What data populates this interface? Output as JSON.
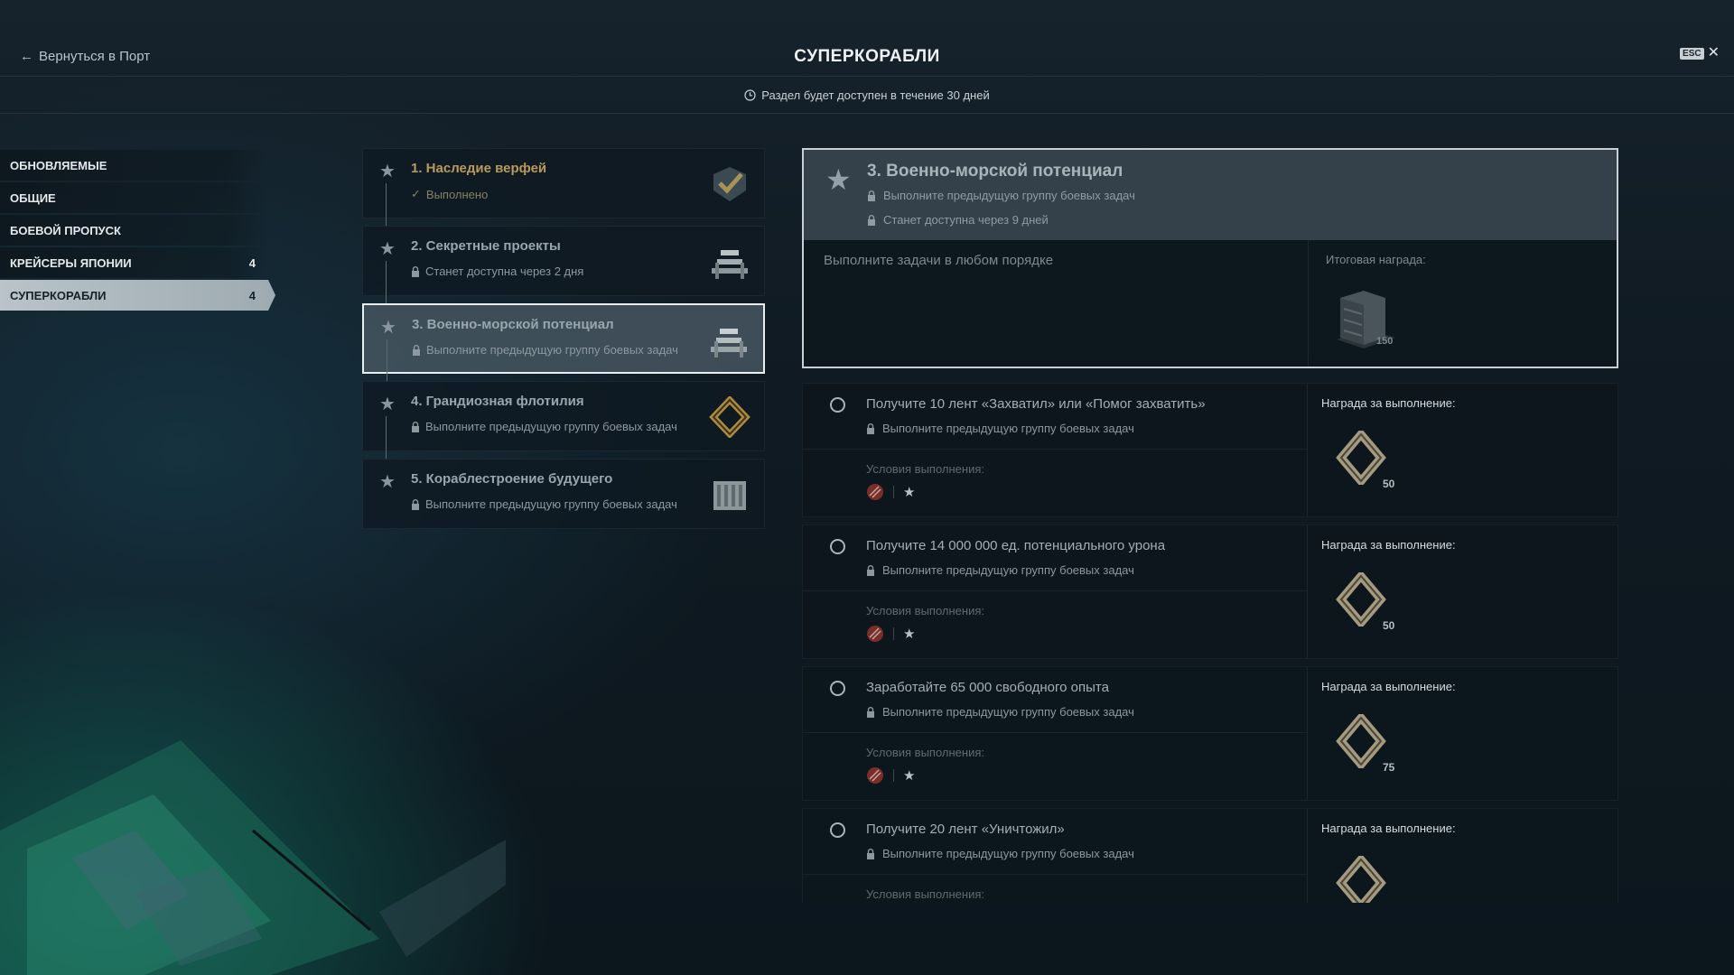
{
  "header": {
    "back_label": "Вернуться в Порт",
    "title": "СУПЕРКОРАБЛИ",
    "esc_key": "ESC",
    "close_glyph": "✕"
  },
  "availability": {
    "text": "Раздел будет доступен в течение 30 дней",
    "icon": "clock-icon"
  },
  "sidebar": {
    "items": [
      {
        "label": "ОБНОВЛЯЕМЫЕ",
        "count": ""
      },
      {
        "label": "ОБЩИЕ",
        "count": ""
      },
      {
        "label": "БОЕВОЙ ПРОПУСК",
        "count": ""
      },
      {
        "label": "КРЕЙСЕРЫ ЯПОНИИ",
        "count": "4"
      },
      {
        "label": "СУПЕРКОРАБЛИ",
        "count": "4",
        "active": true
      }
    ]
  },
  "groups": [
    {
      "title": "1. Наследие верфей",
      "status": "Выполнено",
      "state": "done",
      "icon": "checkmark-badge-icon"
    },
    {
      "title": "2. Секретные проекты",
      "status": "Станет доступна через 2 дня",
      "state": "locked",
      "icon": "steel-ingots-icon"
    },
    {
      "title": "3. Военно-морской потенциал",
      "status": "Выполните предыдущую группу боевых задач",
      "state": "locked",
      "selected": true,
      "icon": "steel-ingots-icon"
    },
    {
      "title": "4. Грандиозная флотилия",
      "status": "Выполните предыдущую группу боевых задач",
      "state": "locked",
      "icon": "coal-diamond-icon"
    },
    {
      "title": "5. Кораблестроение будущего",
      "status": "Выполните предыдущую группу боевых задач",
      "state": "locked",
      "icon": "container-icon"
    }
  ],
  "detail": {
    "title": "3. Военно-морской потенциал",
    "lock_reason_1": "Выполните предыдущую группу боевых задач",
    "lock_reason_2": "Станет доступна через 9 дней",
    "order_hint": "Выполните задачи в любом порядке",
    "final_reward_label": "Итоговая награда:",
    "final_reward_amount": "150",
    "final_reward_icon": "steel-stack-icon"
  },
  "tasks": [
    {
      "title": "Получите 10 лент «Захватил» или «Помог захватить»",
      "status": "Выполните предыдущую группу боевых задач",
      "conditions_label": "Условия выполнения:",
      "reward_label": "Награда за выполнение:",
      "reward_amount": "50",
      "reward_icon": "coal-diamond-icon"
    },
    {
      "title": "Получите 14 000 000 ед. потенциального урона",
      "status": "Выполните предыдущую группу боевых задач",
      "conditions_label": "Условия выполнения:",
      "reward_label": "Награда за выполнение:",
      "reward_amount": "50",
      "reward_icon": "coal-diamond-icon"
    },
    {
      "title": "Заработайте 65 000 свободного опыта",
      "status": "Выполните предыдущую группу боевых задач",
      "conditions_label": "Условия выполнения:",
      "reward_label": "Награда за выполнение:",
      "reward_amount": "75",
      "reward_icon": "coal-diamond-icon"
    },
    {
      "title": "Получите 20 лент «Уничтожил»",
      "status": "Выполните предыдущую группу боевых задач",
      "conditions_label": "Условия выполнения:",
      "reward_label": "Награда за выполнение:",
      "reward_amount": "",
      "reward_icon": "coal-diamond-icon"
    }
  ],
  "colors": {
    "accent_done": "#b89b5a",
    "selected_border": "#e9eef1",
    "active_sidebar": "#b9c3c9"
  }
}
